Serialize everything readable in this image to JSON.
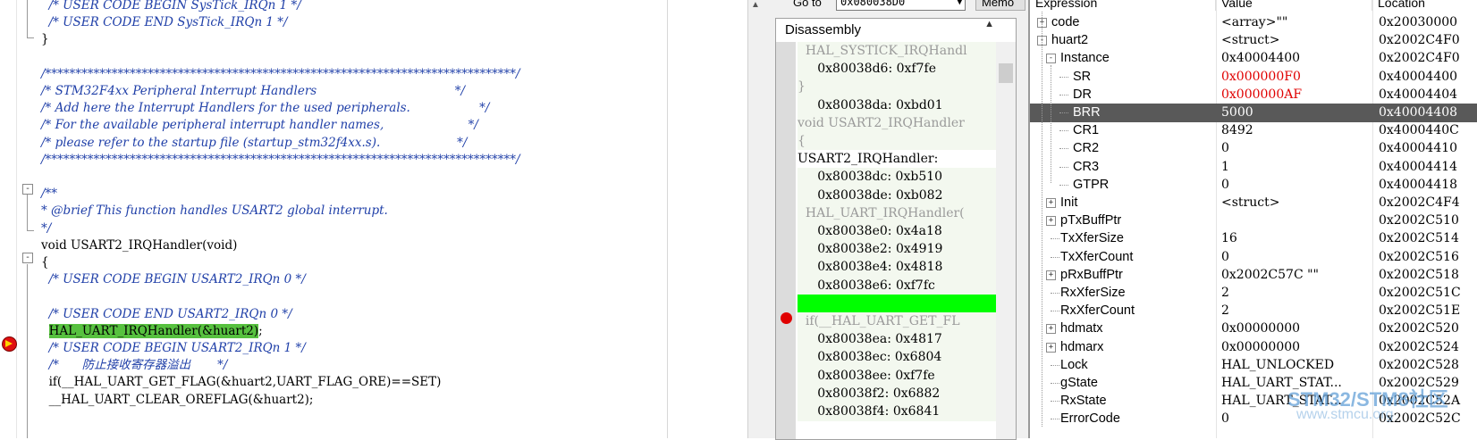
{
  "editor": {
    "lines": [
      {
        "cls": "c-comment",
        "text": "  /* USER CODE BEGIN SysTick_IRQn 1 */"
      },
      {
        "cls": "c-comment",
        "text": "  /* USER CODE END SysTick_IRQn 1 */"
      },
      {
        "cls": "c-code",
        "text": "}"
      },
      {
        "cls": "c-code",
        "text": ""
      },
      {
        "cls": "c-comment",
        "text": "/******************************************************************************/"
      },
      {
        "cls": "c-comment",
        "text": "/* STM32F4xx Peripheral Interrupt Handlers                                    */"
      },
      {
        "cls": "c-comment",
        "text": "/* Add here the Interrupt Handlers for the used peripherals.                  */"
      },
      {
        "cls": "c-comment",
        "text": "/* For the available peripheral interrupt handler names,                      */"
      },
      {
        "cls": "c-comment",
        "text": "/* please refer to the startup file (startup_stm32f4xx.s).                    */"
      },
      {
        "cls": "c-comment",
        "text": "/******************************************************************************/"
      },
      {
        "cls": "c-code",
        "text": ""
      },
      {
        "cls": "c-comment",
        "text": "/**"
      },
      {
        "cls": "c-comment",
        "text": "* @brief This function handles USART2 global interrupt."
      },
      {
        "cls": "c-comment",
        "text": "*/"
      },
      {
        "cls": "c-code",
        "text": "void USART2_IRQHandler(void)"
      },
      {
        "cls": "c-code",
        "text": "{"
      },
      {
        "cls": "c-comment",
        "text": "  /* USER CODE BEGIN USART2_IRQn 0 */"
      },
      {
        "cls": "c-code",
        "text": ""
      },
      {
        "cls": "c-comment",
        "text": "  /* USER CODE END USART2_IRQn 0 */"
      },
      {
        "cls": "c-code",
        "text": "  ",
        "highlight": "HAL_UART_IRQHandler(&huart2)",
        "tail": ";"
      },
      {
        "cls": "c-comment",
        "text": "  /* USER CODE BEGIN USART2_IRQn 1 */"
      },
      {
        "cls": "c-comment",
        "text": "  /*      防止接收寄存器溢出       */"
      },
      {
        "cls": "c-code",
        "text": "  if(__HAL_UART_GET_FLAG(&huart2,UART_FLAG_ORE)==SET)"
      },
      {
        "cls": "c-code",
        "text": "  __HAL_UART_CLEAR_OREFLAG(&huart2);"
      }
    ]
  },
  "goto": {
    "label": "Go to",
    "value": "0x080038D0",
    "memory_button": "Memo"
  },
  "disassembly": {
    "title": "Disassembly",
    "lines": [
      {
        "kind": "src",
        "text": "  HAL_SYSTICK_IRQHandl"
      },
      {
        "kind": "asm",
        "text": "     0x80038d6: 0xf7fe"
      },
      {
        "kind": "src",
        "text": "}"
      },
      {
        "kind": "asm",
        "text": "     0x80038da: 0xbd01"
      },
      {
        "kind": "src",
        "text": "void USART2_IRQHandler"
      },
      {
        "kind": "src",
        "text": "{"
      },
      {
        "kind": "lbl",
        "text": "USART2_IRQHandler:"
      },
      {
        "kind": "asm",
        "text": "     0x80038dc: 0xb510"
      },
      {
        "kind": "asm",
        "text": "     0x80038de: 0xb082"
      },
      {
        "kind": "src",
        "text": "  HAL_UART_IRQHandler("
      },
      {
        "kind": "asm",
        "text": "     0x80038e0: 0x4a18"
      },
      {
        "kind": "asm",
        "text": "     0x80038e2: 0x4919"
      },
      {
        "kind": "asm",
        "text": "     0x80038e4: 0x4818"
      },
      {
        "kind": "asm",
        "text": "     0x80038e6: 0xf7fc"
      },
      {
        "kind": "cur",
        "text": ""
      },
      {
        "kind": "src",
        "text": "  if(__HAL_UART_GET_FL"
      },
      {
        "kind": "asm",
        "text": "     0x80038ea: 0x4817"
      },
      {
        "kind": "asm",
        "text": "     0x80038ec: 0x6804"
      },
      {
        "kind": "asm",
        "text": "     0x80038ee: 0xf7fe"
      },
      {
        "kind": "asm",
        "text": "     0x80038f2: 0x6882"
      },
      {
        "kind": "asm",
        "text": "     0x80038f4: 0x6841"
      }
    ]
  },
  "watch": {
    "headers": {
      "expression": "Expression",
      "value": "Value",
      "location": "Location"
    },
    "rows": [
      {
        "name": "code",
        "value": "<array>\"\"",
        "location": "0x20030000",
        "depth": 0,
        "exp": "+"
      },
      {
        "name": "huart2",
        "value": "<struct>",
        "location": "0x2002C4F0",
        "depth": 0,
        "exp": "-"
      },
      {
        "name": "Instance",
        "value": "0x40004400",
        "location": "0x2002C4F0",
        "depth": 1,
        "exp": "-"
      },
      {
        "name": "SR",
        "value": "0x000000F0",
        "location": "0x40004400",
        "depth": 2,
        "red": true
      },
      {
        "name": "DR",
        "value": "0x000000AF",
        "location": "0x40004404",
        "depth": 2,
        "red": true
      },
      {
        "name": "BRR",
        "value": "5000",
        "location": "0x40004408",
        "depth": 2,
        "sel": true
      },
      {
        "name": "CR1",
        "value": "8492",
        "location": "0x4000440C",
        "depth": 2
      },
      {
        "name": "CR2",
        "value": "0",
        "location": "0x40004410",
        "depth": 2
      },
      {
        "name": "CR3",
        "value": "1",
        "location": "0x40004414",
        "depth": 2
      },
      {
        "name": "GTPR",
        "value": "0",
        "location": "0x40004418",
        "depth": 2
      },
      {
        "name": "Init",
        "value": "<struct>",
        "location": "0x2002C4F4",
        "depth": 1,
        "exp": "+"
      },
      {
        "name": "pTxBuffPtr",
        "value": "",
        "location": "0x2002C510",
        "depth": 1,
        "exp": "+"
      },
      {
        "name": "TxXferSize",
        "value": "16",
        "location": "0x2002C514",
        "depth": 1
      },
      {
        "name": "TxXferCount",
        "value": "0",
        "location": "0x2002C516",
        "depth": 1
      },
      {
        "name": "pRxBuffPtr",
        "value": "0x2002C57C \"\"",
        "location": "0x2002C518",
        "depth": 1,
        "exp": "+"
      },
      {
        "name": "RxXferSize",
        "value": "2",
        "location": "0x2002C51C",
        "depth": 1
      },
      {
        "name": "RxXferCount",
        "value": "2",
        "location": "0x2002C51E",
        "depth": 1
      },
      {
        "name": "hdmatx",
        "value": "0x00000000",
        "location": "0x2002C520",
        "depth": 1,
        "exp": "+"
      },
      {
        "name": "hdmarx",
        "value": "0x00000000",
        "location": "0x2002C524",
        "depth": 1,
        "exp": "+"
      },
      {
        "name": "Lock",
        "value": "HAL_UNLOCKED",
        "location": "0x2002C528",
        "depth": 1
      },
      {
        "name": "gState",
        "value": "HAL_UART_STAT...",
        "location": "0x2002C529",
        "depth": 1
      },
      {
        "name": "RxState",
        "value": "HAL_UART_STAT...",
        "location": "0x2002C52A",
        "depth": 1
      },
      {
        "name": "ErrorCode",
        "value": "0",
        "location": "0x2002C52C",
        "depth": 1
      }
    ]
  },
  "watermark": {
    "brand": "STM32/STM8社区",
    "url": "www.stmcu.org"
  }
}
